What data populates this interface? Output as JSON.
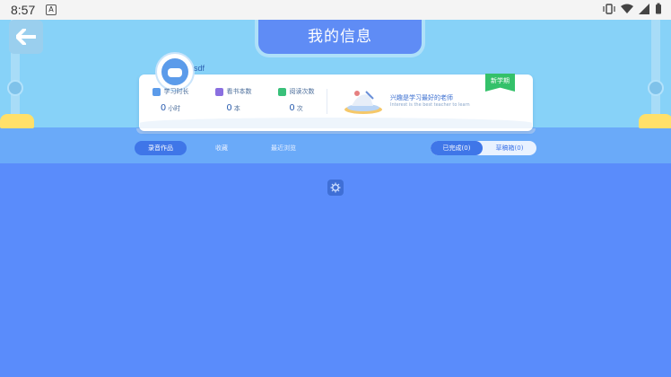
{
  "status_bar": {
    "time": "8:57",
    "notification_letter": "A"
  },
  "header": {
    "title": "我的信息"
  },
  "profile": {
    "username": "sdf"
  },
  "stats": [
    {
      "label": "学习时长",
      "value": "0",
      "unit": "小时",
      "color": "#5b9bea"
    },
    {
      "label": "看书本数",
      "value": "0",
      "unit": "本",
      "color": "#8a6fe0"
    },
    {
      "label": "阅读次数",
      "value": "0",
      "unit": "次",
      "color": "#39c07a"
    }
  ],
  "banner": {
    "slogan": "兴趣是学习最好的老师",
    "slogan_en": "Interest is the best teacher to learn",
    "ribbon": "新学期"
  },
  "tabs": [
    "录音作品",
    "收藏",
    "最近浏览"
  ],
  "segment": {
    "done": "已完成(0)",
    "draft": "草稿箱(0)"
  },
  "colors": {
    "sky": "#87d2f8",
    "background": "#5a8cfb",
    "accent": "#3f76e8"
  }
}
